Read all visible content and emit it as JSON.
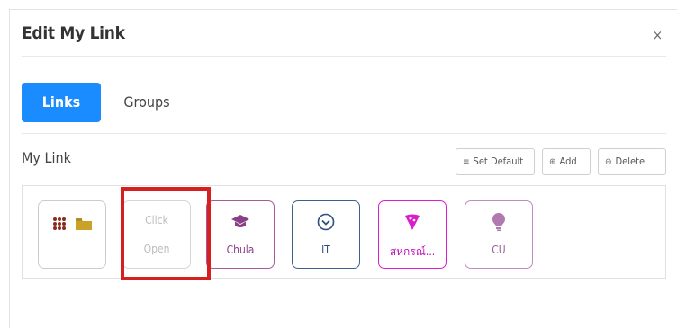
{
  "dialog": {
    "title": "Edit My Link",
    "close_symbol": "×"
  },
  "tabs": [
    {
      "label": "Links",
      "active": true
    },
    {
      "label": "Groups",
      "active": false
    }
  ],
  "section": {
    "title": "My Link"
  },
  "toolbar": {
    "set_default": {
      "icon": "list-icon",
      "label": "Set Default"
    },
    "add": {
      "icon": "plus-circle-icon",
      "label": "Add"
    },
    "delete": {
      "icon": "minus-circle-icon",
      "label": "Delete"
    }
  },
  "tiles": [
    {
      "type": "apps-folder",
      "icons": [
        "apps-grid-icon",
        "folder-icon"
      ]
    },
    {
      "type": "placeholder",
      "line1": "Click",
      "line2": "Open"
    },
    {
      "type": "link",
      "label": "Chula",
      "icon": "graduation-cap-icon",
      "color": "#8a3f86"
    },
    {
      "type": "link",
      "label": "IT",
      "icon": "chevron-down-circle-icon",
      "color": "#2f4f7f"
    },
    {
      "type": "link",
      "label": "สหกรณ์...",
      "icon": "pizza-icon",
      "color": "#d81fcb"
    },
    {
      "type": "link",
      "label": "CU",
      "icon": "lightbulb-icon",
      "color": "#b07ab0"
    }
  ],
  "colors": {
    "accent": "#1a8cff",
    "highlight": "#d61f1f",
    "folder": "#c9a227",
    "apps_grid": "#8b2b1c"
  }
}
